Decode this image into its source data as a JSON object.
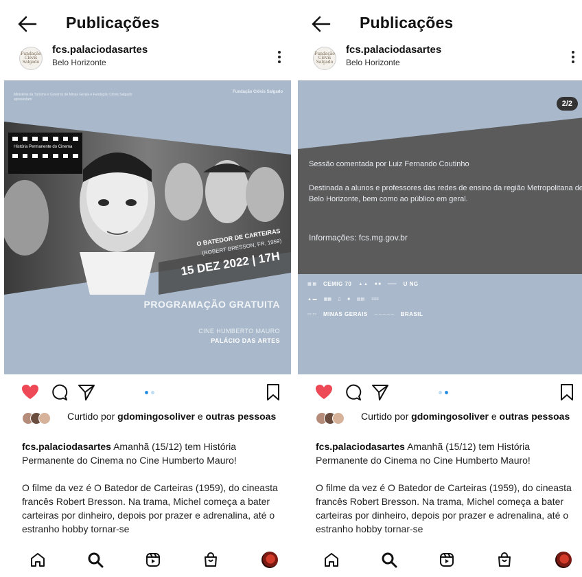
{
  "screens": [
    {
      "header": {
        "title": "Publicações"
      },
      "account": {
        "name": "fcs.palaciodasartes",
        "location": "Belo Horizonte",
        "avatar_text": "Fundação Clóvis Salgado"
      },
      "poster": {
        "top_left": "Ministério da Turismo e Governo de Minas Gerais e Fundação Clóvis Salgado apresentam",
        "top_right": "Fundação Clóvis Salgado",
        "filmstrip": "História Permanente do Cinema",
        "film_title": "O BATEDOR DE CARTEIRAS",
        "film_sub": "(ROBERT BRESSON, FR, 1959)",
        "film_date": "15 DEZ 2022 | 17H",
        "program": "PROGRAMAÇÃO GRATUITA",
        "venue1": "CINE HUMBERTO MAURO",
        "venue2": "PALÁCIO DAS ARTES"
      },
      "carousel": {
        "count": 2,
        "active": 1
      },
      "likes": {
        "prefix": "Curtido por ",
        "user": "gdomingosoliver",
        "mid": " e ",
        "others": "outras pessoas"
      },
      "caption": {
        "user": "fcs.palaciodasartes",
        "text": " Amanhã (15/12) tem História Permanente do Cinema no Cine Humberto Mauro!",
        "paragraph": "O filme da vez é O Batedor de Carteiras (1959), do cineasta francês Robert Bresson. Na trama, Michel começa a bater carteiras por dinheiro, depois por prazer e adrenalina, até o estranho hobby tornar-se"
      }
    },
    {
      "header": {
        "title": "Publicações"
      },
      "account": {
        "name": "fcs.palaciodasartes",
        "location": "Belo Horizonte",
        "avatar_text": "Fundação Clóvis Salgado"
      },
      "poster": {
        "badge": "2/2",
        "line1": "Sessão comentada por Luiz Fernando Coutinho",
        "line2": "Destinada a alunos e professores das redes de ensino da região Metropolitana de Belo Horizonte, bem como ao público em geral.",
        "line3": "Informações: fcs.mg.gov.br",
        "logos": [
          "CEMIG 70",
          "U NG",
          "MINAS GERAIS",
          "BRASIL"
        ]
      },
      "carousel": {
        "count": 2,
        "active": 2
      },
      "likes": {
        "prefix": "Curtido por ",
        "user": "gdomingosoliver",
        "mid": " e ",
        "others": "outras pessoas"
      },
      "caption": {
        "user": "fcs.palaciodasartes",
        "text": " Amanhã (15/12) tem História Permanente do Cinema no Cine Humberto Mauro!",
        "paragraph": "O filme da vez é O Batedor de Carteiras (1959), do cineasta francês Robert Bresson. Na trama, Michel começa a bater carteiras por dinheiro, depois por prazer e adrenalina, até o estranho hobby tornar-se"
      }
    }
  ],
  "colors": {
    "like_red": "#ed4956",
    "poster_blue": "#a9b9cb",
    "band_gray": "#5a5a5a",
    "accent_blue": "#2b8fe0"
  },
  "nav": {
    "icons": [
      "home-icon",
      "search-icon",
      "reels-icon",
      "shop-icon",
      "profile-avatar"
    ]
  }
}
